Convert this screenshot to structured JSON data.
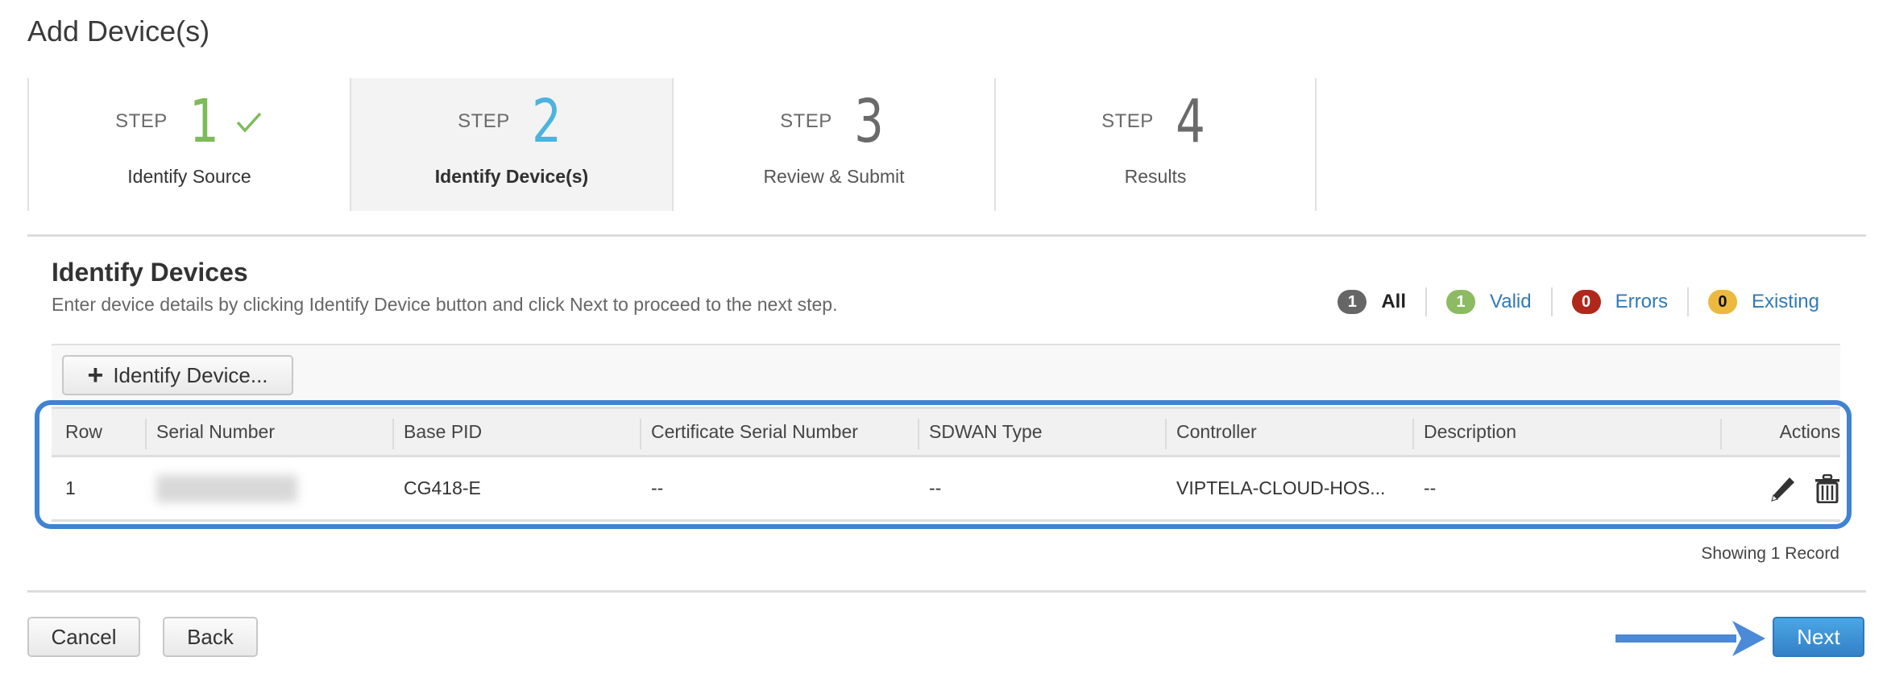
{
  "page": {
    "title": "Add Device(s)"
  },
  "steps": [
    {
      "word": "STEP",
      "number": "1",
      "label": "Identify Source",
      "state": "completed",
      "icon": "check-icon"
    },
    {
      "word": "STEP",
      "number": "2",
      "label": "Identify Device(s)",
      "state": "active"
    },
    {
      "word": "STEP",
      "number": "3",
      "label": "Review & Submit",
      "state": "pending"
    },
    {
      "word": "STEP",
      "number": "4",
      "label": "Results",
      "state": "pending"
    }
  ],
  "section": {
    "title": "Identify Devices",
    "description": "Enter device details by clicking Identify Device button and click Next to proceed to the next step."
  },
  "counts": [
    {
      "count": "1",
      "label": "All",
      "color": "#666666"
    },
    {
      "count": "1",
      "label": "Valid",
      "color": "#8dbb63"
    },
    {
      "count": "0",
      "label": "Errors",
      "color": "#b0271c"
    },
    {
      "count": "0",
      "label": "Existing",
      "color": "#ecb83e"
    }
  ],
  "toolbar": {
    "identify_label": "Identify Device...",
    "identify_icon": "plus-icon"
  },
  "table": {
    "columns": [
      "Row",
      "Serial Number",
      "Base PID",
      "Certificate Serial Number",
      "SDWAN Type",
      "Controller",
      "Description",
      "Actions"
    ],
    "rows": [
      {
        "row": "1",
        "serial_number": "",
        "base_pid": "CG418-E",
        "certificate_serial": "--",
        "sdwan_type": "--",
        "controller": "VIPTELA-CLOUD-HOS...",
        "description": "--",
        "actions": [
          "edit-icon",
          "delete-icon"
        ]
      }
    ],
    "footer": "Showing 1 Record"
  },
  "footer": {
    "cancel_label": "Cancel",
    "back_label": "Back",
    "next_label": "Next"
  },
  "colors": {
    "accent": "#3f83d2",
    "primary_button": "#3a8fd4",
    "step_done": "#7dbb5b",
    "step_current": "#4bb4de"
  }
}
